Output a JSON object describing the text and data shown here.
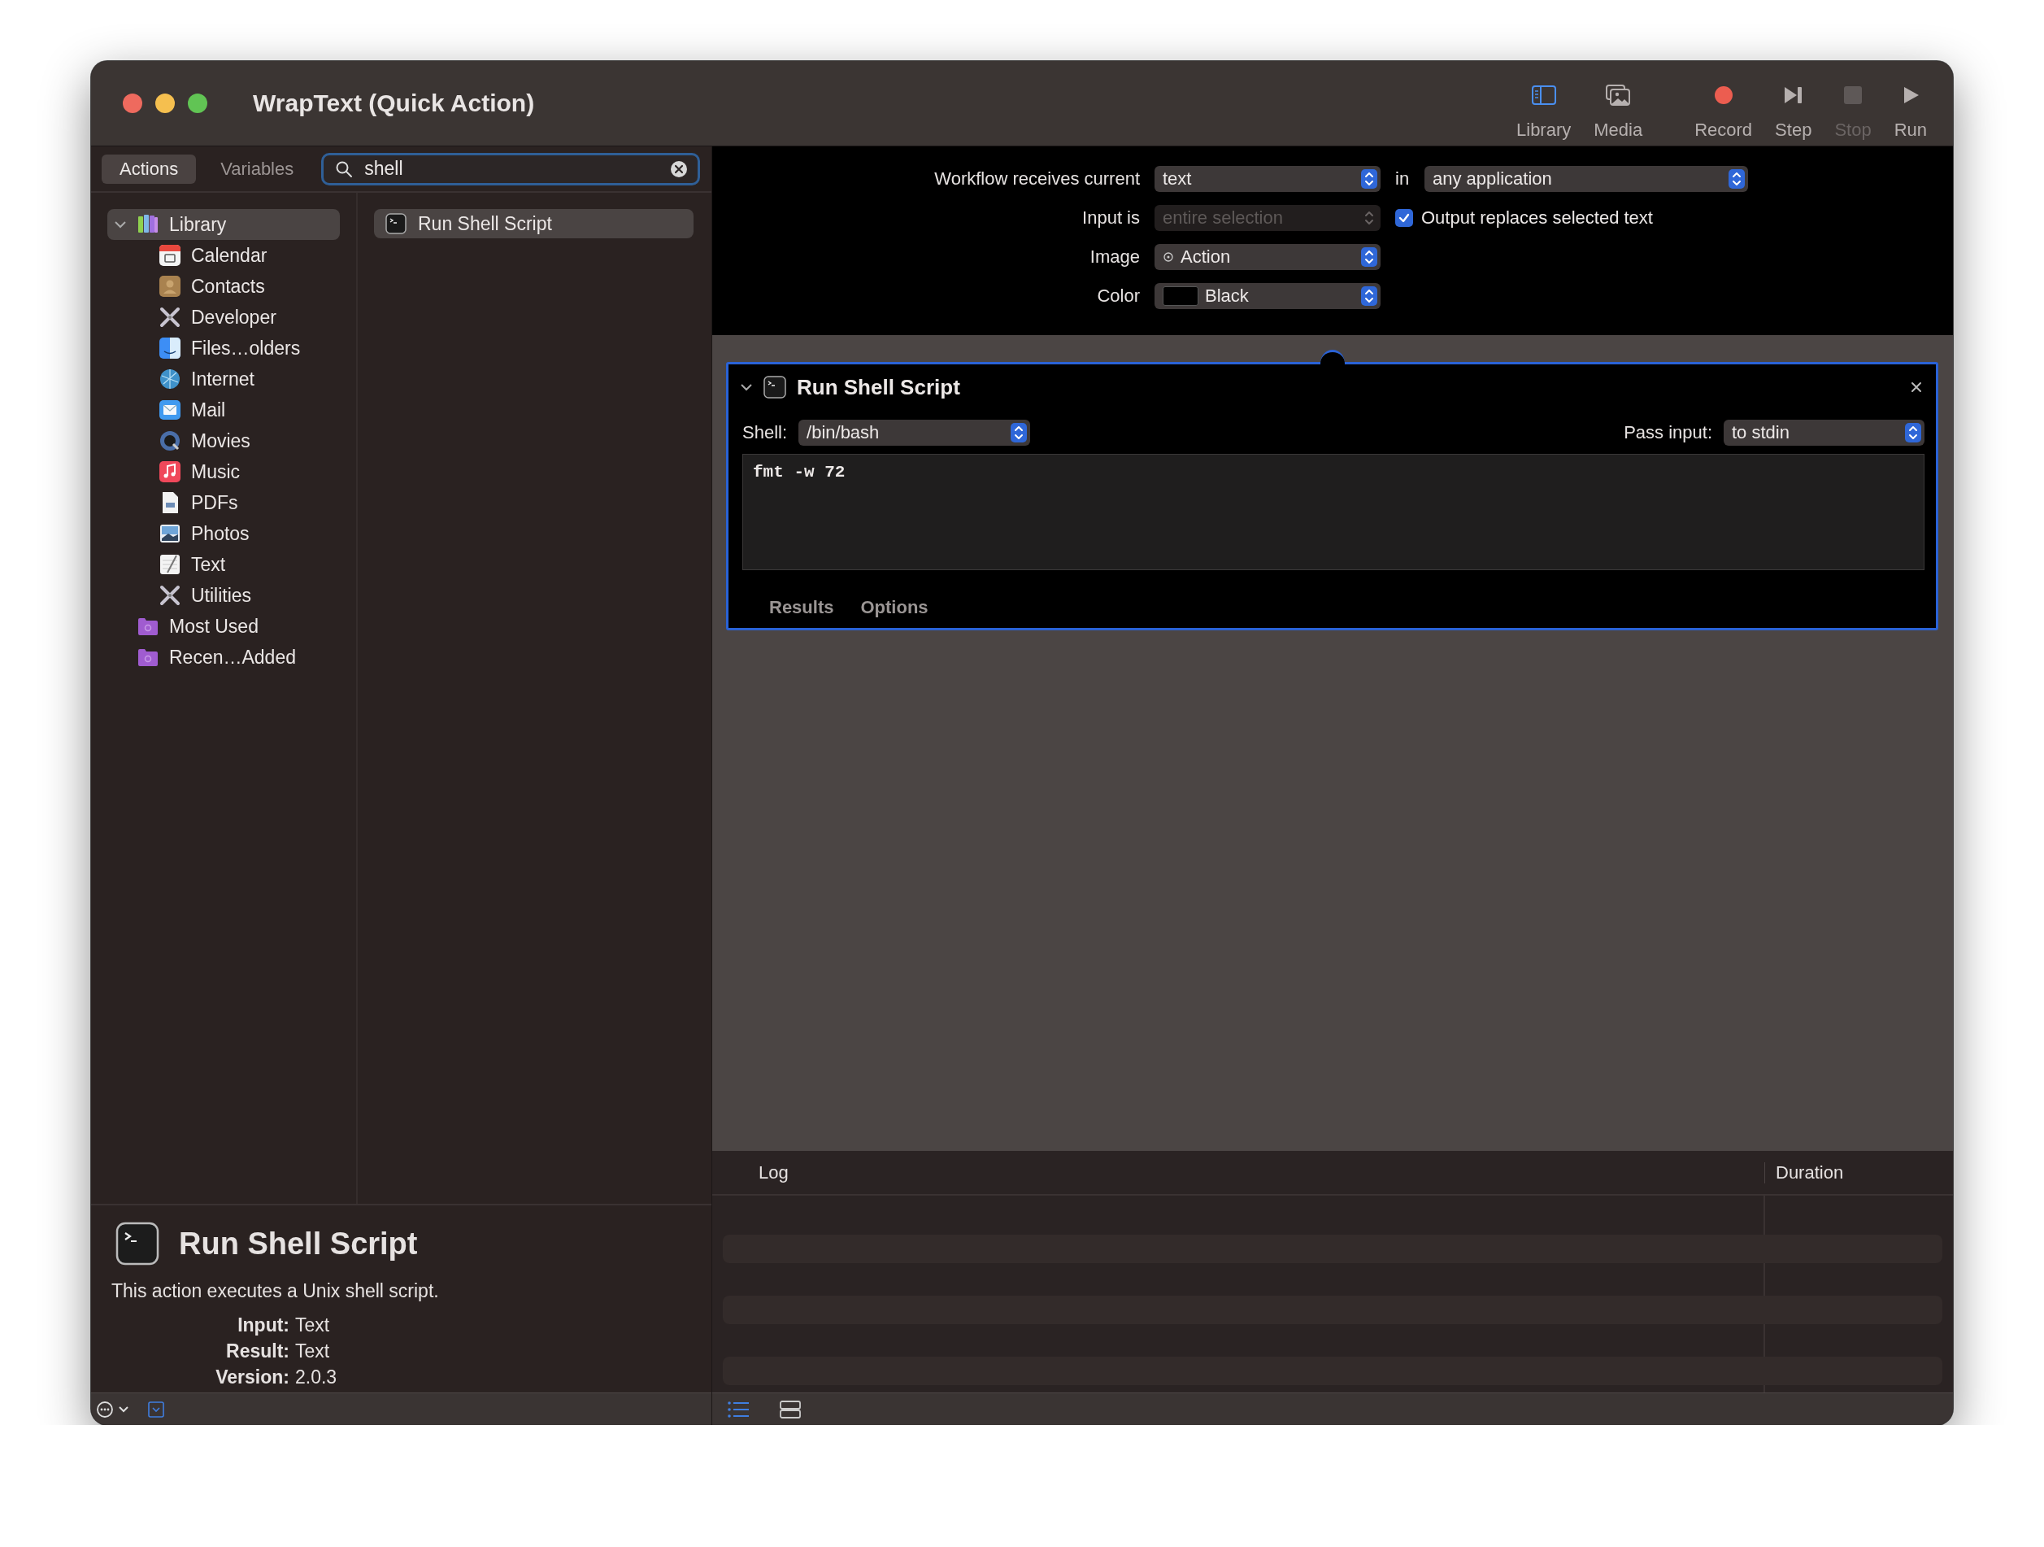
{
  "window": {
    "title": "WrapText (Quick Action)"
  },
  "toolbar": [
    {
      "label": "Library",
      "on": true,
      "disabled": false
    },
    {
      "label": "Media",
      "on": false,
      "disabled": false
    },
    {
      "label": "Record",
      "on": false,
      "disabled": false
    },
    {
      "label": "Step",
      "on": false,
      "disabled": false
    },
    {
      "label": "Stop",
      "on": false,
      "disabled": true
    },
    {
      "label": "Run",
      "on": false,
      "disabled": false
    }
  ],
  "sidebar": {
    "tabs": [
      {
        "label": "Actions",
        "selected": true
      },
      {
        "label": "Variables",
        "selected": false
      }
    ],
    "search": {
      "value": "shell"
    },
    "library_tree": [
      {
        "label": "Library",
        "selected": true,
        "expanded": true,
        "children": [
          {
            "label": "Calendar",
            "selected": false
          },
          {
            "label": "Contacts",
            "selected": false
          },
          {
            "label": "Developer",
            "selected": false
          },
          {
            "label": "Files…olders",
            "selected": false
          },
          {
            "label": "Internet",
            "selected": false
          },
          {
            "label": "Mail",
            "selected": false
          },
          {
            "label": "Movies",
            "selected": false
          },
          {
            "label": "Music",
            "selected": false
          },
          {
            "label": "PDFs",
            "selected": false
          },
          {
            "label": "Photos",
            "selected": false
          },
          {
            "label": "Text",
            "selected": false
          },
          {
            "label": "Utilities",
            "selected": false
          }
        ]
      },
      {
        "label": "Most Used",
        "selected": false
      },
      {
        "label": "Recen…Added",
        "selected": false
      }
    ],
    "actions": [
      {
        "label": "Run Shell Script",
        "selected": true
      }
    ],
    "description": {
      "title": "Run Shell Script",
      "text": "This action executes a Unix shell script.",
      "details": [
        {
          "label": "Input:",
          "value": "Text"
        },
        {
          "label": "Result:",
          "value": "Text"
        },
        {
          "label": "Version:",
          "value": "2.0.3"
        }
      ]
    }
  },
  "workflow_header": {
    "receives_label": "Workflow receives current",
    "receives_value": "text",
    "in_label": "in",
    "application_value": "any application",
    "input_label": "Input is",
    "input_value": "entire selection",
    "input_disabled": true,
    "output_replaces": {
      "label": "Output replaces selected text",
      "checked": true
    },
    "image_label": "Image",
    "image_value": "Action",
    "color_label": "Color",
    "color_value": "Black"
  },
  "action_card": {
    "title": "Run Shell Script",
    "expanded": true,
    "shell_label": "Shell:",
    "shell_value": "/bin/bash",
    "pass_label": "Pass input:",
    "pass_value": "to stdin",
    "script": "fmt -w 72",
    "tabs": [
      {
        "label": "Results"
      },
      {
        "label": "Options"
      }
    ]
  },
  "log": {
    "columns": [
      "Log",
      "Duration"
    ]
  }
}
